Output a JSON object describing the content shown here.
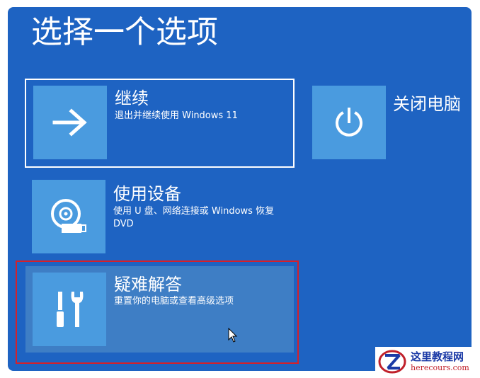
{
  "header": {
    "title": "选择一个选项"
  },
  "options": {
    "continue": {
      "title": "继续",
      "description": "退出并继续使用 Windows 11",
      "icon": "arrow-right-icon"
    },
    "use_device": {
      "title": "使用设备",
      "description": "使用 U 盘、网络连接或 Windows 恢复 DVD",
      "icon": "disc-drive-icon"
    },
    "troubleshoot": {
      "title": "疑难解答",
      "description": "重置你的电脑或查看高级选项",
      "icon": "tools-icon"
    },
    "shutdown": {
      "title": "关闭电脑",
      "icon": "power-icon"
    }
  },
  "watermark": {
    "name": "这里教程网",
    "url": "herecours.com"
  },
  "colors": {
    "background": "#1e63c2",
    "tile": "#4a9bdf",
    "selected": "#3e7ec5",
    "highlight": "#d6202a"
  }
}
